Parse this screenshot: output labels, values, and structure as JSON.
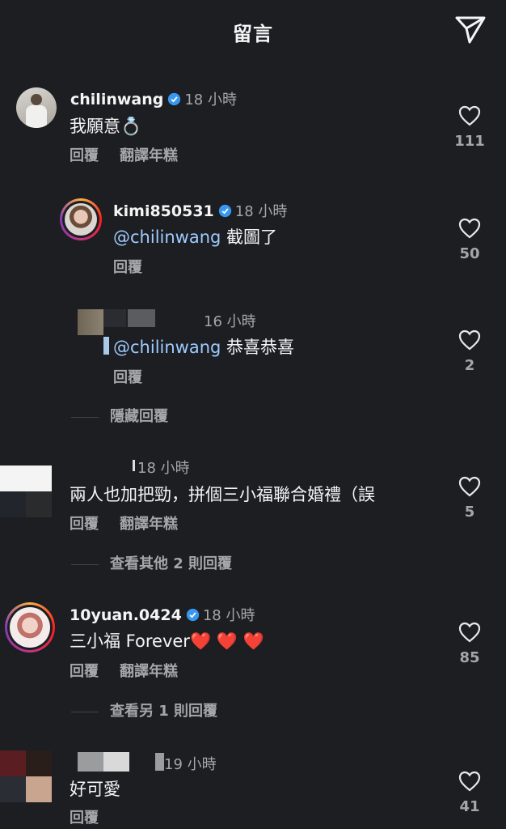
{
  "header": {
    "title": "留言",
    "send_icon": "send-icon"
  },
  "labels": {
    "reply": "回覆",
    "translate": "翻譯年糕"
  },
  "comments": [
    {
      "username": "chilinwang",
      "verified": true,
      "time": "18 小時",
      "text": "我願意",
      "emoji": "💍",
      "likes": "111"
    },
    {
      "username": "kimi850531",
      "verified": true,
      "time": "18 小時",
      "mention": "@chilinwang",
      "text": " 截圖了",
      "likes": "50"
    },
    {
      "username": "",
      "time": "16 小時",
      "mention": "@chilinwang",
      "text": " 恭喜恭喜",
      "likes": "2",
      "hide_replies": "隱藏回覆"
    },
    {
      "username": "",
      "time": "18 小時",
      "text": "兩人也加把勁，拼個三小福聯合婚禮（誤",
      "likes": "5",
      "view_more": "查看其他 2 則回覆"
    },
    {
      "username": "10yuan.0424",
      "verified": true,
      "time": "18 小時",
      "text": "三小福 Forever",
      "emoji": "❤️ ❤️ ❤️",
      "likes": "85",
      "view_more": "查看另 1 則回覆"
    },
    {
      "username": "",
      "time": "19 小時",
      "text": "好可愛",
      "likes": "41"
    }
  ],
  "colors": {
    "background": "#1c1e22",
    "mention": "#9ecbff",
    "secondary": "#a6a6a8",
    "verified": "#3897f0"
  }
}
